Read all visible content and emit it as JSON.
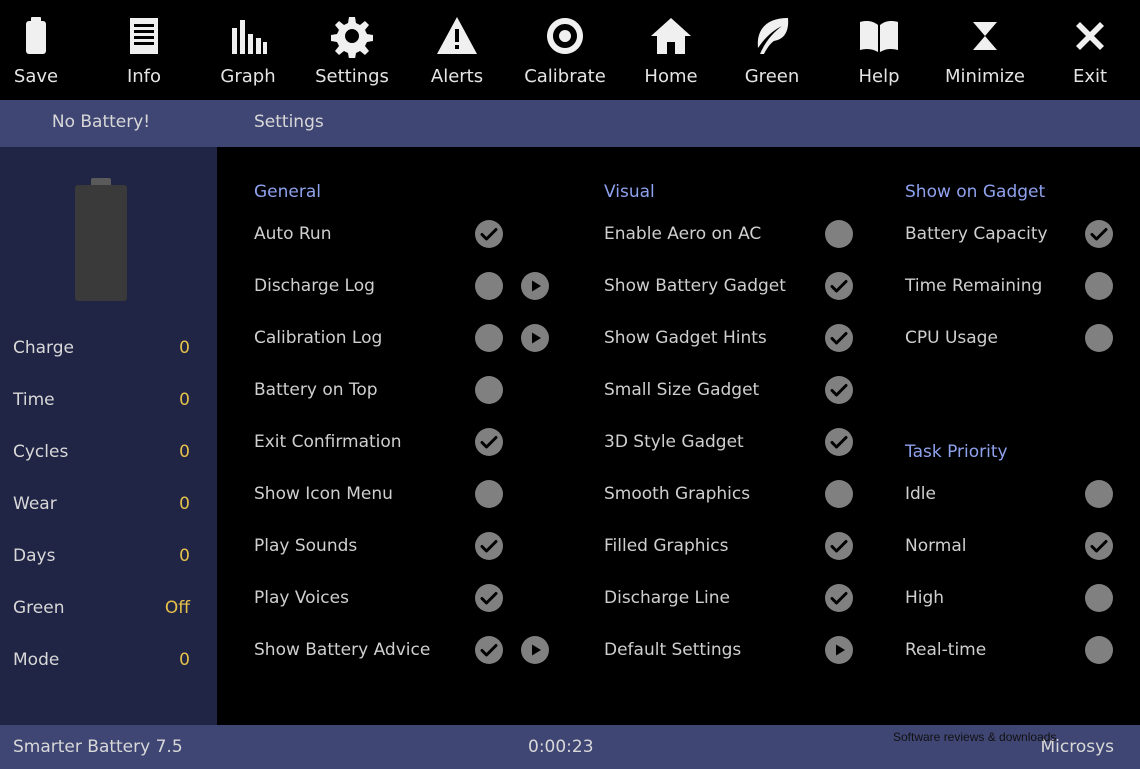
{
  "toolbar": {
    "items": [
      {
        "label": "Save",
        "icon": "battery-icon"
      },
      {
        "label": "Info",
        "icon": "document-icon"
      },
      {
        "label": "Graph",
        "icon": "bar-graph-icon"
      },
      {
        "label": "Settings",
        "icon": "gear-icon"
      },
      {
        "label": "Alerts",
        "icon": "warning-icon"
      },
      {
        "label": "Calibrate",
        "icon": "target-icon"
      },
      {
        "label": "Home",
        "icon": "home-icon"
      },
      {
        "label": "Green",
        "icon": "leaf-icon"
      },
      {
        "label": "Help",
        "icon": "book-icon"
      },
      {
        "label": "Minimize",
        "icon": "minimize-icon"
      },
      {
        "label": "Exit",
        "icon": "close-icon"
      }
    ]
  },
  "header": {
    "status": "No Battery!",
    "title": "Settings"
  },
  "sidebar": {
    "stats": [
      {
        "label": "Charge",
        "value": "0"
      },
      {
        "label": "Time",
        "value": "0"
      },
      {
        "label": "Cycles",
        "value": "0"
      },
      {
        "label": "Wear",
        "value": "0"
      },
      {
        "label": "Days",
        "value": "0"
      },
      {
        "label": "Green",
        "value": "Off"
      },
      {
        "label": "Mode",
        "value": "0"
      }
    ]
  },
  "general": {
    "heading": "General",
    "options": [
      {
        "label": "Auto Run",
        "checked": true,
        "play": false
      },
      {
        "label": "Discharge Log",
        "checked": false,
        "play": true
      },
      {
        "label": "Calibration Log",
        "checked": false,
        "play": true
      },
      {
        "label": "Battery on Top",
        "checked": false,
        "play": false
      },
      {
        "label": "Exit Confirmation",
        "checked": true,
        "play": false
      },
      {
        "label": "Show Icon Menu",
        "checked": false,
        "play": false
      },
      {
        "label": "Play Sounds",
        "checked": true,
        "play": false
      },
      {
        "label": "Play Voices",
        "checked": true,
        "play": false
      },
      {
        "label": "Show Battery Advice",
        "checked": true,
        "play": true
      }
    ]
  },
  "visual": {
    "heading": "Visual",
    "options": [
      {
        "label": "Enable Aero on AC",
        "checked": false
      },
      {
        "label": "Show Battery Gadget",
        "checked": true
      },
      {
        "label": "Show Gadget Hints",
        "checked": true
      },
      {
        "label": "Small Size Gadget",
        "checked": true
      },
      {
        "label": "3D Style Gadget",
        "checked": true
      },
      {
        "label": "Smooth Graphics",
        "checked": false
      },
      {
        "label": "Filled Graphics",
        "checked": true
      },
      {
        "label": "Discharge Line",
        "checked": true
      },
      {
        "label": "Default Settings",
        "checked": false,
        "play": true
      }
    ]
  },
  "gadget": {
    "heading": "Show on Gadget",
    "options": [
      {
        "label": "Battery Capacity",
        "checked": true
      },
      {
        "label": "Time Remaining",
        "checked": false
      },
      {
        "label": "CPU Usage",
        "checked": false
      }
    ]
  },
  "priority": {
    "heading": "Task Priority",
    "options": [
      {
        "label": "Idle",
        "checked": false
      },
      {
        "label": "Normal",
        "checked": true
      },
      {
        "label": "High",
        "checked": false
      },
      {
        "label": "Real-time",
        "checked": false
      }
    ]
  },
  "statusbar": {
    "app": "Smarter Battery 7.5",
    "elapsed": "0:00:23",
    "brand": "Microsys"
  },
  "watermark": {
    "tagline": "Software reviews & downloads"
  },
  "colors": {
    "accent_heading": "#8fa2ee",
    "stat_value": "#e6c14a",
    "bar": "#3f4674",
    "sidebar": "#202445"
  }
}
